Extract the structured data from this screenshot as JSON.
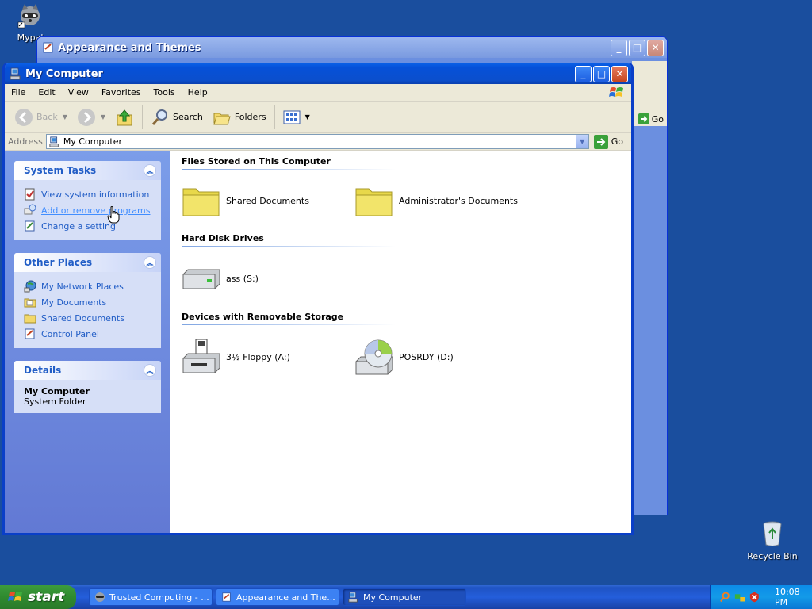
{
  "desktop": {
    "icons": [
      {
        "label": "Mypal"
      },
      {
        "label": "Recycle Bin"
      }
    ]
  },
  "background_window": {
    "title": "Appearance and Themes",
    "go_label": "Go"
  },
  "window": {
    "title": "My Computer",
    "menu": [
      "File",
      "Edit",
      "View",
      "Favorites",
      "Tools",
      "Help"
    ],
    "toolbar": {
      "back": "Back",
      "search": "Search",
      "folders": "Folders"
    },
    "address": {
      "label": "Address",
      "value": "My Computer",
      "go": "Go"
    },
    "taskpane": {
      "system_tasks": {
        "title": "System Tasks",
        "items": [
          "View system information",
          "Add or remove programs",
          "Change a setting"
        ]
      },
      "other_places": {
        "title": "Other Places",
        "items": [
          "My Network Places",
          "My Documents",
          "Shared Documents",
          "Control Panel"
        ]
      },
      "details": {
        "title": "Details",
        "name": "My Computer",
        "type": "System Folder"
      }
    },
    "groups": [
      {
        "title": "Files Stored on This Computer",
        "items": [
          "Shared Documents",
          "Administrator's Documents"
        ]
      },
      {
        "title": "Hard Disk Drives",
        "items": [
          "ass (S:)"
        ]
      },
      {
        "title": "Devices with Removable Storage",
        "items": [
          "3½ Floppy (A:)",
          "POSRDY (D:)"
        ]
      }
    ]
  },
  "taskbar": {
    "start": "start",
    "tasks": [
      "Trusted Computing - ...",
      "Appearance and The...",
      "My Computer"
    ],
    "clock": "10:08 PM"
  },
  "colors": {
    "desktop": "#1a4e9e",
    "titlebar": "#0a5fe6",
    "link": "#215dc6",
    "taskpane": "#7b9de9"
  }
}
